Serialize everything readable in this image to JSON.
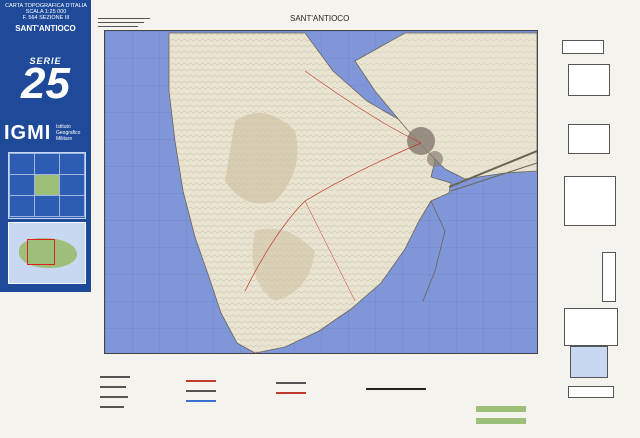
{
  "cover": {
    "title_lines": [
      "CARTA TOPOGRAFICA D'ITALIA",
      "SCALA 1:25 000",
      "F. 564 SEZIONE III"
    ],
    "sheet_name": "SANT'ANTIOCO",
    "serie_label": "SERIE",
    "serie_number": "25",
    "org_abbrev": "IGMI",
    "org_full_lines": [
      "Istituto",
      "Geografico",
      "Militare"
    ]
  },
  "map": {
    "title": "SANT'ANTIOCO",
    "colors": {
      "sea": "#7f96d8",
      "land": "#e9e3d2",
      "relief": "#b9ad8f",
      "town": "#8a7f73",
      "frame": "#444444",
      "cover": "#1f4a9a"
    }
  }
}
